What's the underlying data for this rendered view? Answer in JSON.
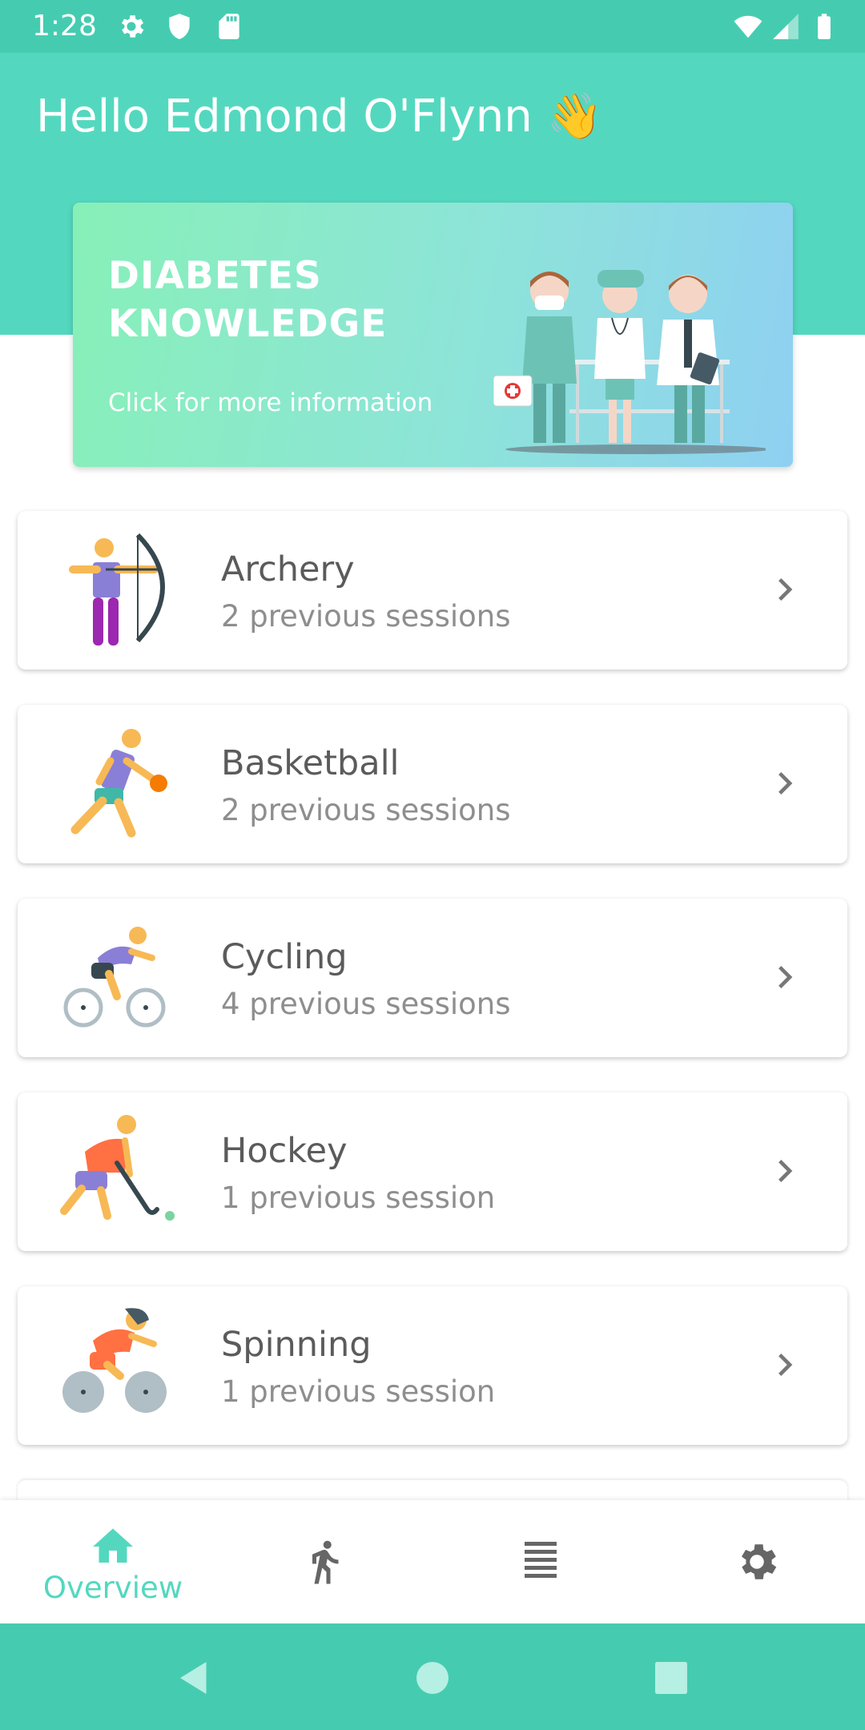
{
  "status_bar": {
    "time": "1:28",
    "icons": [
      "settings-icon",
      "shield-icon",
      "sd-card-icon",
      "wifi-icon",
      "signal-icon",
      "battery-icon"
    ]
  },
  "header": {
    "greeting": "Hello Edmond O'Flynn 👋",
    "background_color": "#53d8bf"
  },
  "banner": {
    "title": "DIABETES KNOWLEDGE",
    "subtitle": "Click for more information"
  },
  "sports": [
    {
      "name": "Archery",
      "sessions": "2 previous sessions",
      "icon": "archery-icon"
    },
    {
      "name": "Basketball",
      "sessions": "2 previous sessions",
      "icon": "basketball-icon"
    },
    {
      "name": "Cycling",
      "sessions": "4 previous sessions",
      "icon": "cycling-icon"
    },
    {
      "name": "Hockey",
      "sessions": "1 previous session",
      "icon": "hockey-icon"
    },
    {
      "name": "Spinning",
      "sessions": "1 previous session",
      "icon": "spinning-icon"
    }
  ],
  "bottom_nav": {
    "items": [
      {
        "label": "Overview",
        "icon": "home-icon",
        "active": true
      },
      {
        "label": "",
        "icon": "running-icon",
        "active": false
      },
      {
        "label": "",
        "icon": "list-icon",
        "active": false
      },
      {
        "label": "",
        "icon": "settings-icon",
        "active": false
      }
    ],
    "active_color": "#53d8bf",
    "inactive_color": "#666666"
  },
  "system_nav": {
    "buttons": [
      "back-icon",
      "home-circle-icon",
      "recents-icon"
    ]
  }
}
